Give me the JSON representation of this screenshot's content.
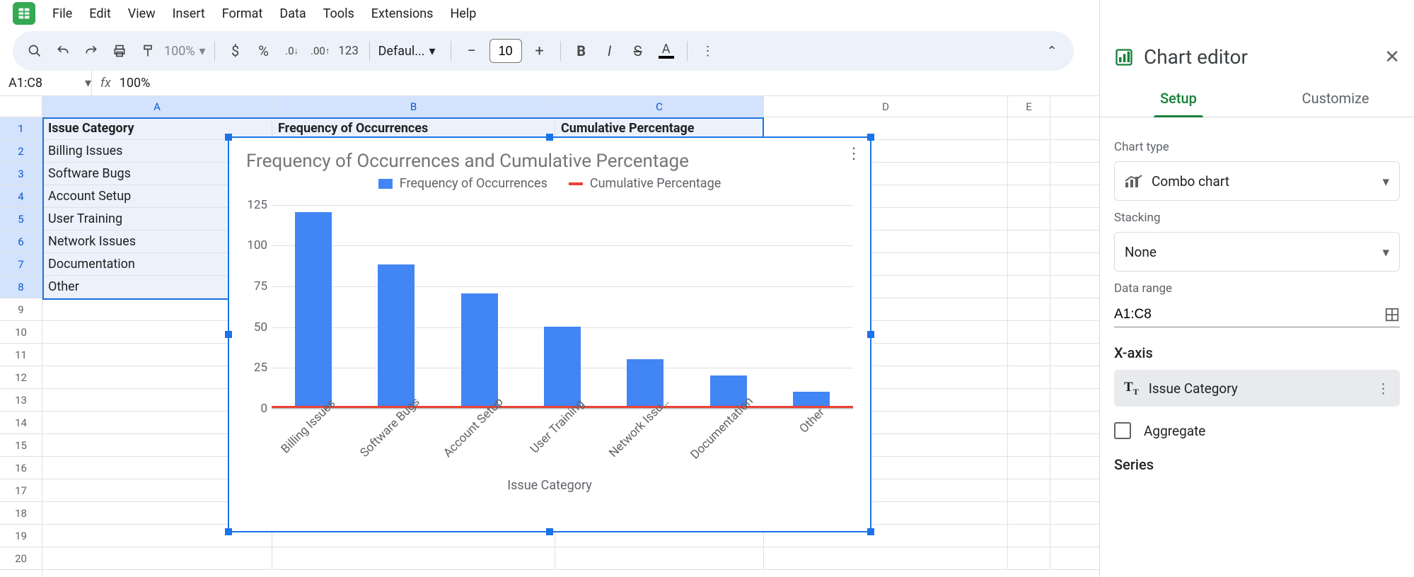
{
  "menu": {
    "items": [
      "File",
      "Edit",
      "View",
      "Insert",
      "Format",
      "Data",
      "Tools",
      "Extensions",
      "Help"
    ]
  },
  "toolbar": {
    "zoom": "100%",
    "font_family": "Defaul...",
    "font_size": "10",
    "numfmt_123": "123"
  },
  "namebox": {
    "ref": "A1:C8",
    "fx_value": "100%"
  },
  "columns": [
    "A",
    "B",
    "C",
    "D",
    "E"
  ],
  "row_numbers": [
    1,
    2,
    3,
    4,
    5,
    6,
    7,
    8,
    9,
    10,
    11,
    12,
    13,
    14,
    15,
    16,
    17,
    18,
    19,
    20
  ],
  "sheet": {
    "headers": {
      "a": "Issue Category",
      "b": "Frequency of Occurrences",
      "c": "Cumulative Percentage"
    },
    "rows": [
      {
        "a": "Billing Issues"
      },
      {
        "a": "Software Bugs"
      },
      {
        "a": "Account Setup"
      },
      {
        "a": "User Training"
      },
      {
        "a": "Network Issues"
      },
      {
        "a": "Documentation"
      },
      {
        "a": "Other"
      }
    ]
  },
  "chart_data": {
    "type": "bar",
    "title": "Frequency of Occurrences and Cumulative Percentage",
    "xlabel": "Issue Category",
    "ylabel": "",
    "ylim": [
      0,
      130
    ],
    "yticks": [
      0,
      25,
      50,
      75,
      100,
      125
    ],
    "categories": [
      "Billing Issues",
      "Software Bugs",
      "Account Setup",
      "User Training",
      "Network Issu…",
      "Documentation",
      "Other"
    ],
    "series": [
      {
        "name": "Frequency of Occurrences",
        "type": "bar",
        "color": "#4285f4",
        "values": [
          120,
          88,
          70,
          50,
          30,
          20,
          10
        ]
      },
      {
        "name": "Cumulative Percentage",
        "type": "line",
        "color": "#ea4335",
        "values": [
          0,
          0,
          0,
          0,
          0,
          0,
          0
        ]
      }
    ]
  },
  "editor": {
    "title": "Chart editor",
    "tabs": {
      "setup": "Setup",
      "customize": "Customize"
    },
    "chart_type_label": "Chart type",
    "chart_type_value": "Combo chart",
    "stacking_label": "Stacking",
    "stacking_value": "None",
    "data_range_label": "Data range",
    "data_range_value": "A1:C8",
    "xaxis_label": "X-axis",
    "xaxis_value": "Issue Category",
    "aggregate": "Aggregate",
    "series_label": "Series"
  }
}
